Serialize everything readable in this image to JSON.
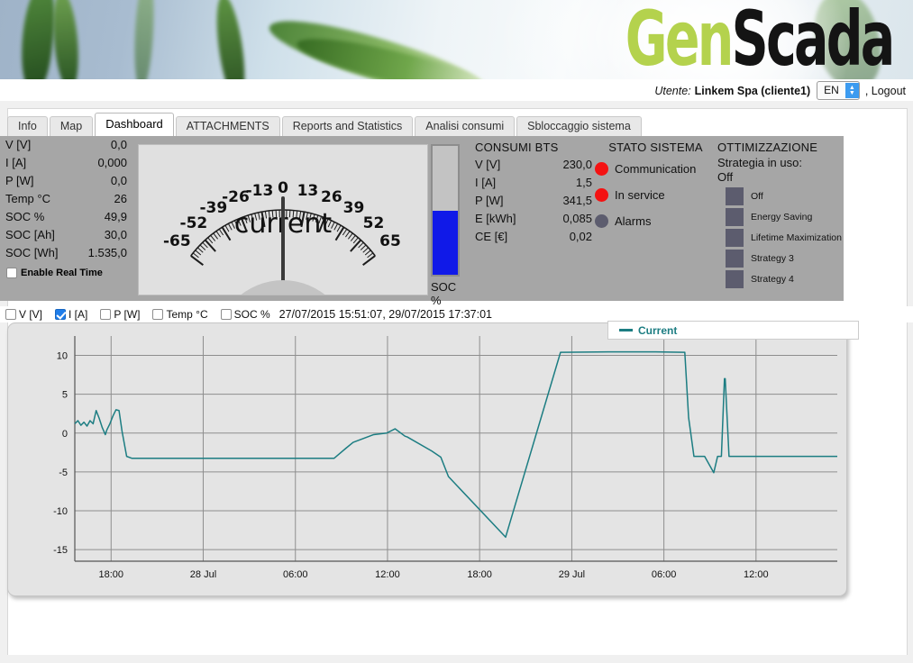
{
  "brand": {
    "part1": "Gen",
    "part2": "Scada",
    "green": "#b4d24d",
    "dark": "#141414"
  },
  "userbar": {
    "user_label": "Utente:",
    "user_name": "Linkem Spa (cliente1)",
    "language": "EN",
    "logout": ", Logout"
  },
  "tabs": [
    {
      "label": "Info",
      "active": false
    },
    {
      "label": "Map",
      "active": false
    },
    {
      "label": "Dashboard",
      "active": true
    },
    {
      "label": "ATTACHMENTS",
      "active": false
    },
    {
      "label": "Reports and Statistics",
      "active": false
    },
    {
      "label": "Analisi consumi",
      "active": false
    },
    {
      "label": "Sbloccaggio sistema",
      "active": false
    }
  ],
  "left_values": {
    "rows": [
      {
        "label": "V [V]",
        "value": "0,0"
      },
      {
        "label": "I [A]",
        "value": "0,000"
      },
      {
        "label": "P [W]",
        "value": "0,0"
      },
      {
        "label": "Temp °C",
        "value": "26"
      },
      {
        "label": "SOC %",
        "value": "49,9"
      },
      {
        "label": "SOC [Ah]",
        "value": "30,0"
      },
      {
        "label": "SOC [Wh]",
        "value": "1.535,0"
      }
    ],
    "realtime_label": "Enable Real Time",
    "realtime_checked": false
  },
  "gauge": {
    "title": "current",
    "ticks": [
      "-65",
      "-52",
      "-39",
      "-26",
      "-13",
      "0",
      "13",
      "26",
      "39",
      "52",
      "65"
    ],
    "min": -65,
    "max": 65,
    "value": 0
  },
  "soc": {
    "label": "SOC %",
    "percent": 49.9,
    "fill_color": "#1019e8"
  },
  "consumi": {
    "title": "CONSUMI BTS",
    "rows": [
      {
        "label": "V [V]",
        "value": "230,0"
      },
      {
        "label": "I [A]",
        "value": "1,5"
      },
      {
        "label": "P [W]",
        "value": "341,5"
      },
      {
        "label": "E [kWh]",
        "value": "0,085"
      },
      {
        "label": "CE [€]",
        "value": "0,02"
      }
    ]
  },
  "stato": {
    "title": "STATO SISTEMA",
    "items": [
      {
        "label": "Communication",
        "color": "#f41212"
      },
      {
        "label": "In service",
        "color": "#f41212"
      },
      {
        "label": "Alarms",
        "color": "#5c5c6e"
      }
    ]
  },
  "ottimizzazione": {
    "title": "OTTIMIZZAZIONE",
    "strategy_label": "Strategia in uso:",
    "strategy_value": "Off",
    "options": [
      {
        "label": "Off"
      },
      {
        "label": "Energy Saving"
      },
      {
        "label": "Lifetime Maximization"
      },
      {
        "label": "Strategy 3"
      },
      {
        "label": "Strategy 4"
      }
    ]
  },
  "series_selector": {
    "items": [
      {
        "label": "V [V]",
        "checked": false
      },
      {
        "label": "I [A]",
        "checked": true
      },
      {
        "label": "P [W]",
        "checked": false
      },
      {
        "label": "Temp °C",
        "checked": false
      },
      {
        "label": "SOC %",
        "checked": false
      }
    ],
    "timestamp": "27/07/2015 15:51:07, 29/07/2015 17:37:01"
  },
  "chart_data": {
    "type": "line",
    "title": "",
    "xlabel": "",
    "ylabel": "",
    "legend": [
      {
        "name": "Current",
        "color": "#1c7d82"
      }
    ],
    "legend_position": "top-right",
    "grid": true,
    "ylim": [
      -16.5,
      12.5
    ],
    "yticks": [
      10,
      5,
      0,
      -5,
      -10,
      -15
    ],
    "xticks": [
      "18:00",
      "28 Jul",
      "06:00",
      "12:00",
      "18:00",
      "29 Jul",
      "06:00",
      "12:00"
    ],
    "xtick_positions": [
      0.0476,
      0.1684,
      0.2893,
      0.4101,
      0.5309,
      0.6518,
      0.7726,
      0.8934
    ],
    "series": [
      {
        "name": "Current",
        "color": "#1c7d82",
        "x": [
          0.0,
          0.004,
          0.008,
          0.012,
          0.016,
          0.02,
          0.024,
          0.028,
          0.032,
          0.036,
          0.04,
          0.042,
          0.046,
          0.05,
          0.054,
          0.058,
          0.062,
          0.068,
          0.075,
          0.34,
          0.355,
          0.365,
          0.392,
          0.409,
          0.42,
          0.433,
          0.436,
          0.468,
          0.48,
          0.49,
          0.565,
          0.637,
          0.7,
          0.762,
          0.8,
          0.805,
          0.812,
          0.826,
          0.838,
          0.843,
          0.848,
          0.852,
          0.853,
          0.858,
          0.862,
          1.0
        ],
        "y": [
          1.2,
          1.6,
          1.0,
          1.4,
          0.9,
          1.6,
          1.2,
          2.9,
          1.9,
          0.7,
          -0.2,
          0.4,
          1.2,
          2.2,
          3.0,
          2.9,
          0.2,
          -3.0,
          -3.25,
          -3.25,
          -2.0,
          -1.2,
          -0.2,
          0.0,
          0.55,
          -0.4,
          -0.5,
          -2.3,
          -3.1,
          -5.6,
          -13.4,
          10.4,
          10.45,
          10.45,
          10.4,
          2.0,
          -3.0,
          -3.0,
          -5.1,
          -3.0,
          -3.0,
          7.0,
          7.0,
          -3.0,
          -3.0,
          -3.0
        ]
      }
    ]
  }
}
